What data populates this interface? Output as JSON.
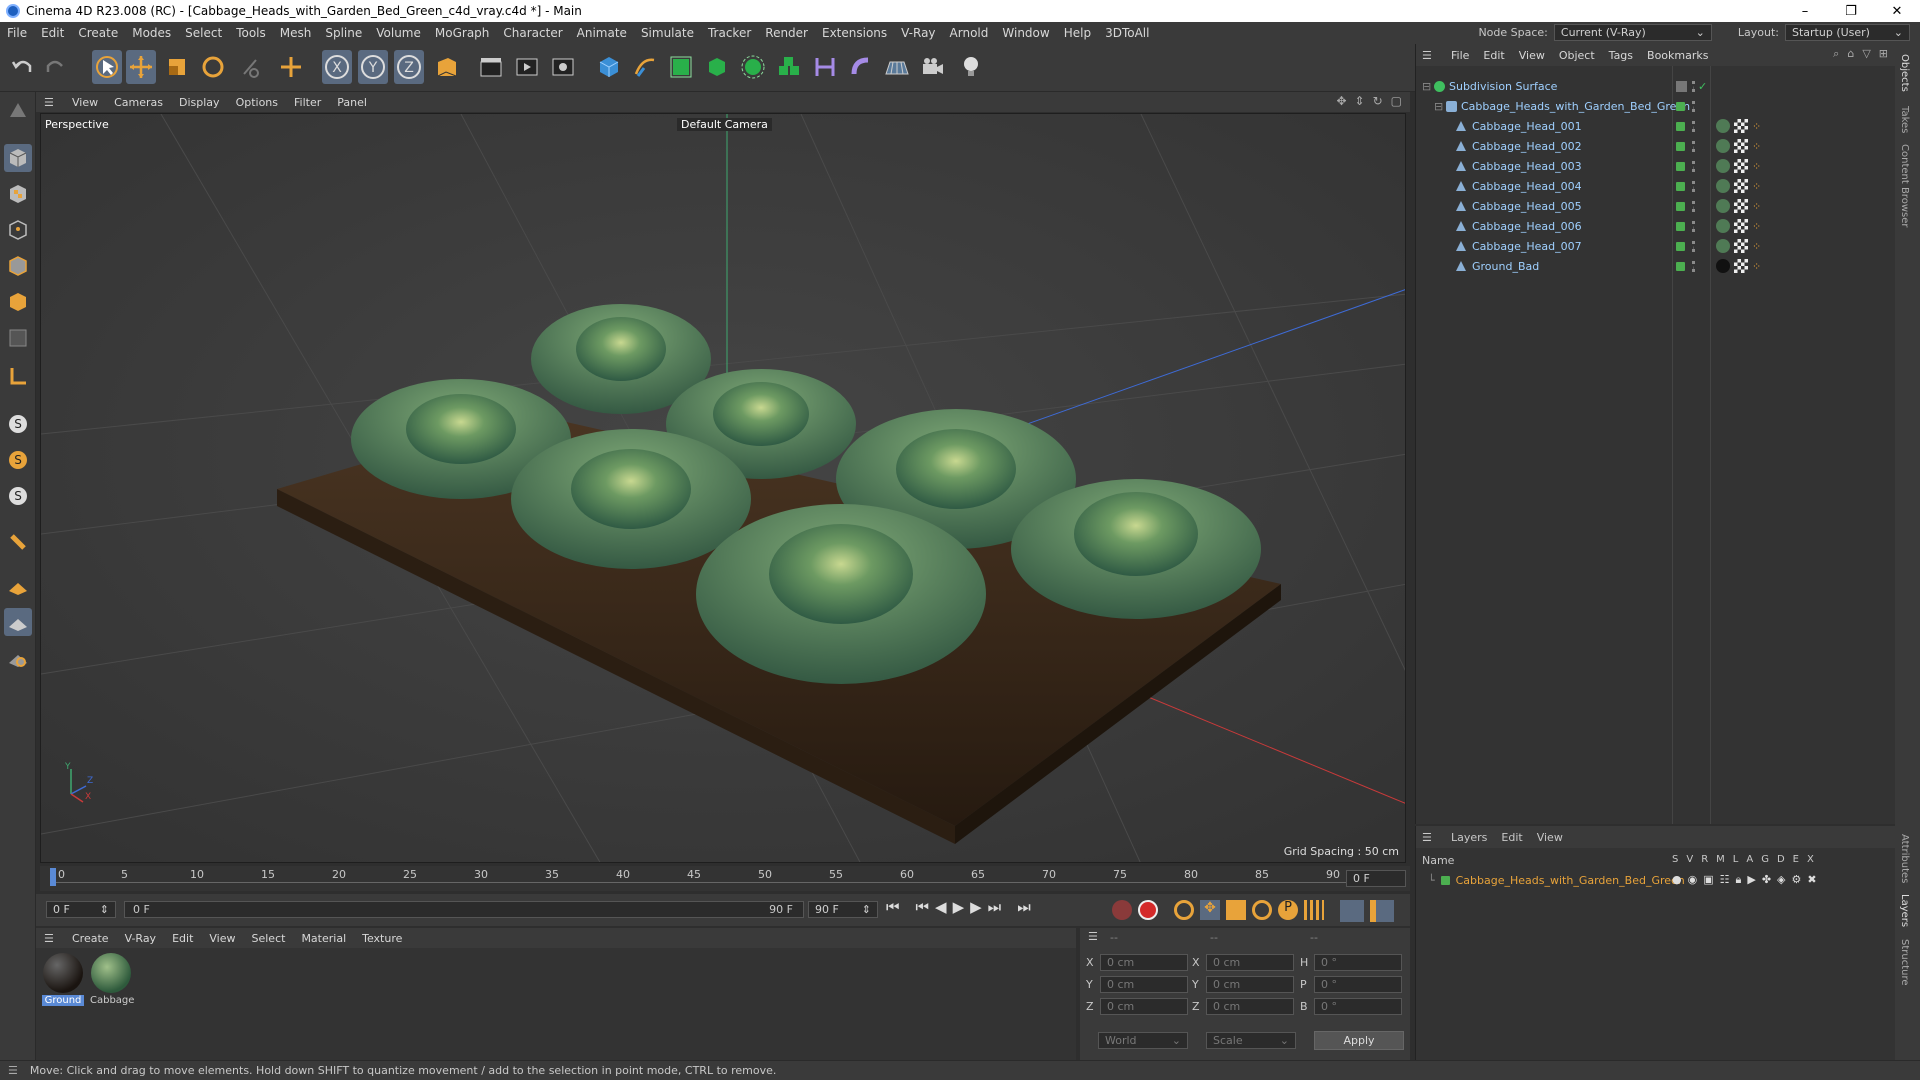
{
  "window": {
    "title": "Cinema 4D R23.008 (RC) - [Cabbage_Heads_with_Garden_Bed_Green_c4d_vray.c4d *] - Main",
    "controls": [
      "–",
      "❐",
      "✕"
    ]
  },
  "menubar": {
    "items": [
      "File",
      "Edit",
      "Create",
      "Modes",
      "Select",
      "Tools",
      "Mesh",
      "Spline",
      "Volume",
      "MoGraph",
      "Character",
      "Animate",
      "Simulate",
      "Tracker",
      "Render",
      "Extensions",
      "V-Ray",
      "Arnold",
      "Window",
      "Help",
      "3DToAll"
    ],
    "node_space_label": "Node Space:",
    "node_space_value": "Current (V-Ray)",
    "layout_label": "Layout:",
    "layout_value": "Startup (User)"
  },
  "viewport": {
    "menu": [
      "View",
      "Cameras",
      "Display",
      "Options",
      "Filter",
      "Panel"
    ],
    "view_name": "Perspective",
    "camera_label": "Default Camera",
    "grid_spacing": "Grid Spacing : 50 cm",
    "axis_labels": {
      "y": "Y",
      "z": "Z",
      "x": "X"
    }
  },
  "timeline": {
    "ticks": [
      "0",
      "5",
      "10",
      "15",
      "20",
      "25",
      "30",
      "35",
      "40",
      "45",
      "50",
      "55",
      "60",
      "65",
      "70",
      "75",
      "80",
      "85",
      "90"
    ],
    "current_frame": "0 F"
  },
  "transport": {
    "start_frame": "0 F",
    "range_start": "0 F",
    "range_end": "90 F",
    "end_frame": "90 F"
  },
  "material_manager": {
    "menu": [
      "Create",
      "V-Ray",
      "Edit",
      "View",
      "Select",
      "Material",
      "Texture"
    ],
    "materials": [
      {
        "name": "Ground",
        "selected": true
      },
      {
        "name": "Cabbage",
        "selected": false
      }
    ]
  },
  "coordinates": {
    "headers": [
      "--",
      "--",
      "--"
    ],
    "rows": [
      {
        "a": "X",
        "av": "0 cm",
        "b": "X",
        "bv": "0 cm",
        "c": "H",
        "cv": "0 °"
      },
      {
        "a": "Y",
        "av": "0 cm",
        "b": "Y",
        "bv": "0 cm",
        "c": "P",
        "cv": "0 °"
      },
      {
        "a": "Z",
        "av": "0 cm",
        "b": "Z",
        "bv": "0 cm",
        "c": "B",
        "cv": "0 °"
      }
    ],
    "mode_world": "World",
    "mode_scale": "Scale",
    "apply": "Apply"
  },
  "object_manager": {
    "menu": [
      "File",
      "Edit",
      "View",
      "Object",
      "Tags",
      "Bookmarks"
    ],
    "objects": [
      {
        "name": "Subdivision Surface",
        "indent": 0
      },
      {
        "name": "Cabbage_Heads_with_Garden_Bed_Green",
        "indent": 1
      },
      {
        "name": "Cabbage_Head_001",
        "indent": 2
      },
      {
        "name": "Cabbage_Head_002",
        "indent": 2
      },
      {
        "name": "Cabbage_Head_003",
        "indent": 2
      },
      {
        "name": "Cabbage_Head_004",
        "indent": 2
      },
      {
        "name": "Cabbage_Head_005",
        "indent": 2
      },
      {
        "name": "Cabbage_Head_006",
        "indent": 2
      },
      {
        "name": "Cabbage_Head_007",
        "indent": 2
      },
      {
        "name": "Ground_Bad",
        "indent": 2
      }
    ]
  },
  "layer_manager": {
    "menu": [
      "Layers",
      "Edit",
      "View"
    ],
    "name_header": "Name",
    "flags": [
      "S",
      "V",
      "R",
      "M",
      "L",
      "A",
      "G",
      "D",
      "E",
      "X"
    ],
    "layers": [
      {
        "name": "Cabbage_Heads_with_Garden_Bed_Green"
      }
    ]
  },
  "right_tabs": [
    "Objects",
    "Takes",
    "Content Browser",
    "Attributes",
    "Layers",
    "Structure"
  ],
  "status": {
    "text": "Move: Click and drag to move elements. Hold down SHIFT to quantize movement / add to the selection in point mode, CTRL to remove."
  },
  "colors": {
    "accent": "#5a6a80",
    "layer_green": "#4caf50",
    "selection_orange": "#e8a33a"
  }
}
